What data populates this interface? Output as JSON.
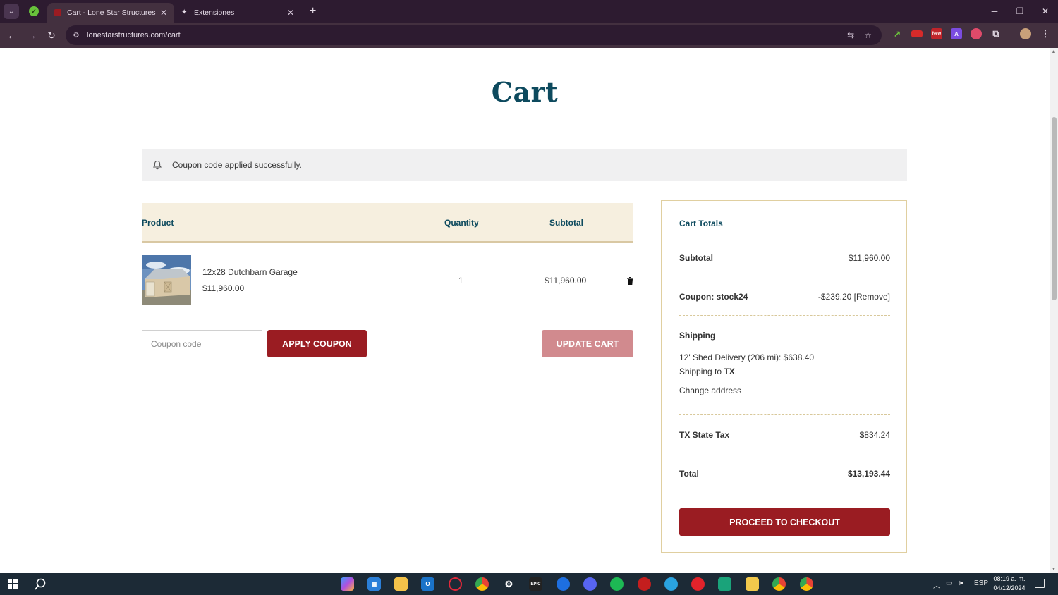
{
  "browser": {
    "tabs": [
      {
        "title": "Cart - Lone Star Structures",
        "active": true
      },
      {
        "title": "Extensiones",
        "active": false
      }
    ],
    "url": "lonestarstructures.com/cart"
  },
  "page": {
    "title": "Cart",
    "notice": "Coupon code applied successfully.",
    "cart_table": {
      "headers": {
        "product": "Product",
        "quantity": "Quantity",
        "subtotal": "Subtotal"
      },
      "items": [
        {
          "name": "12x28 Dutchbarn Garage",
          "price": "$11,960.00",
          "quantity": "1",
          "subtotal": "$11,960.00"
        }
      ]
    },
    "coupon": {
      "placeholder": "Coupon code",
      "apply_label": "APPLY COUPON"
    },
    "update_label": "UPDATE CART",
    "totals": {
      "title": "Cart Totals",
      "subtotal_label": "Subtotal",
      "subtotal_value": "$11,960.00",
      "coupon_label": "Coupon: stock24",
      "coupon_value": "-$239.20",
      "coupon_remove": "[Remove]",
      "shipping_label": "Shipping",
      "shipping_method": "12' Shed Delivery (206 mi): $638.40",
      "shipping_to_prefix": "Shipping to",
      "shipping_state": "TX",
      "change_address": "Change address",
      "tax_label": "TX State Tax",
      "tax_value": "$834.24",
      "total_label": "Total",
      "total_value": "$13,193.44",
      "checkout_label": "PROCEED TO CHECKOUT"
    }
  },
  "taskbar": {
    "language": "ESP",
    "time": "08:19 a. m.",
    "date": "04/12/2024"
  },
  "colors": {
    "brand_teal": "#0d4a5e",
    "button_red": "#9a1c22",
    "button_red_disabled": "#d18a8e",
    "table_head_bg": "#f6efdf",
    "chrome_dark": "#2d1b30"
  }
}
